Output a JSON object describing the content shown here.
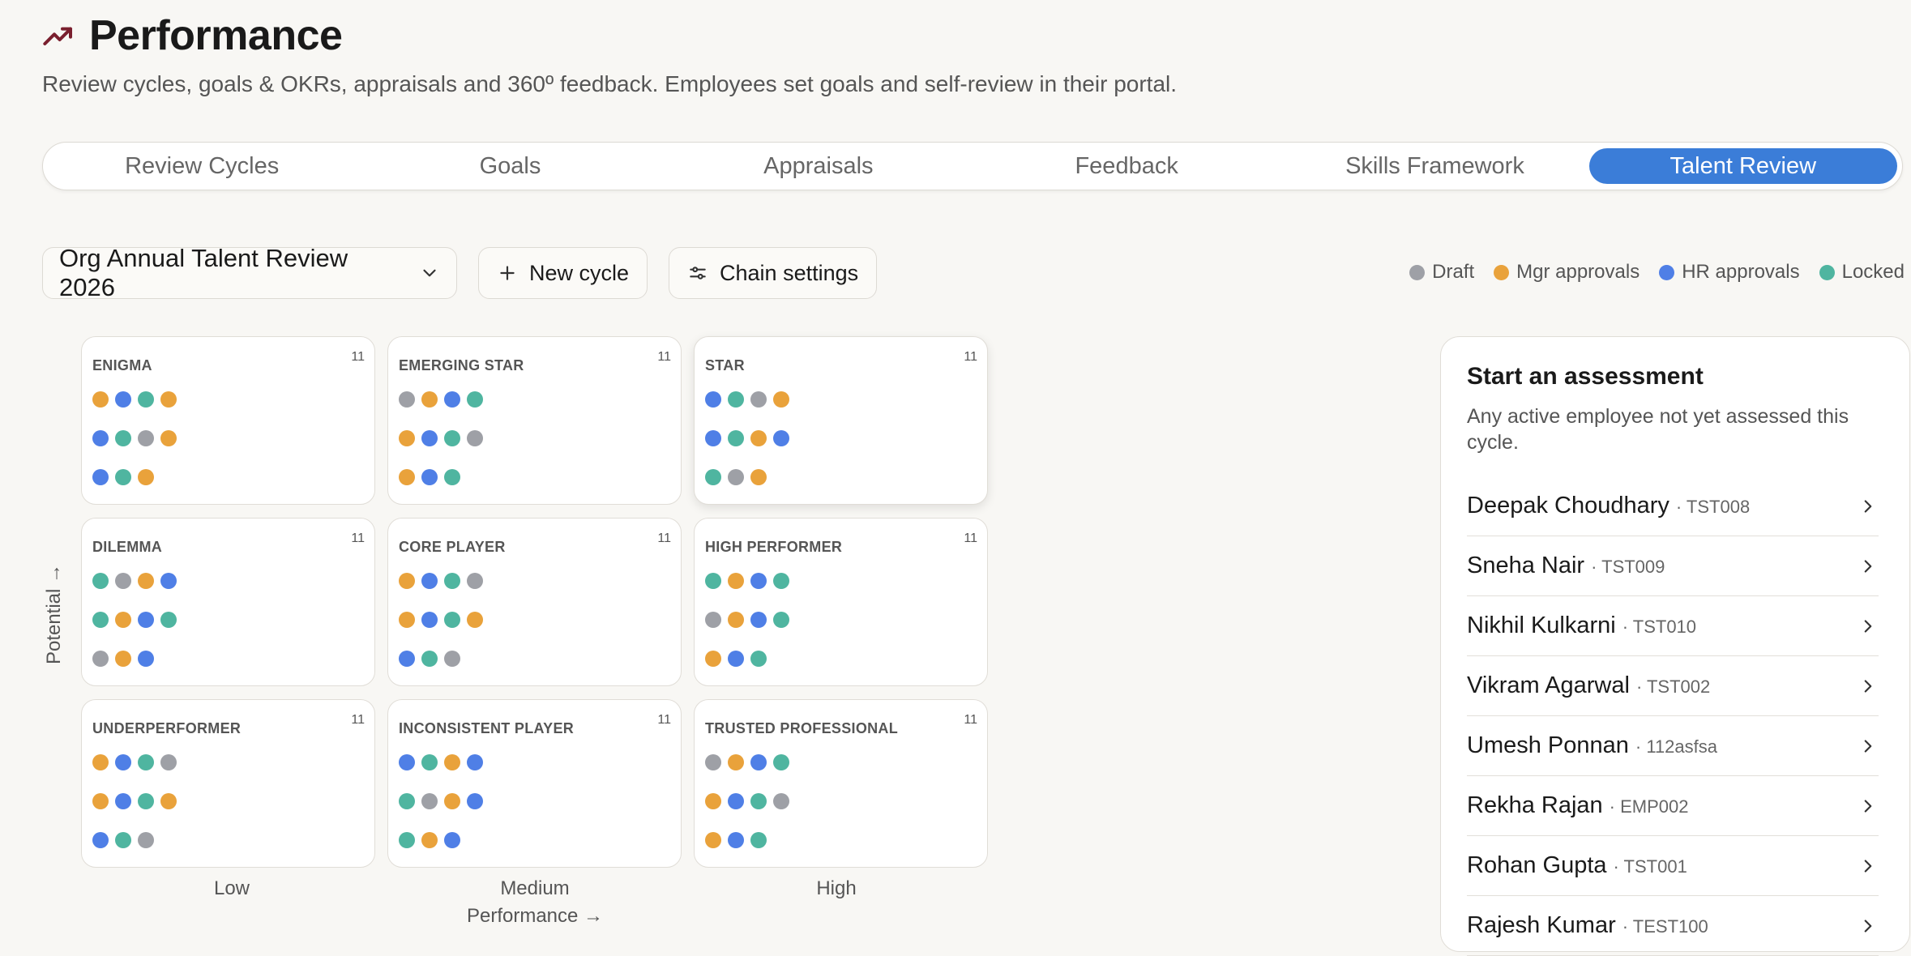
{
  "header": {
    "title": "Performance",
    "subtitle": "Review cycles, goals & OKRs, appraisals and 360º feedback. Employees set goals and self-review in their portal.",
    "accent": "#7a1f2e"
  },
  "tabs": [
    {
      "label": "Review Cycles",
      "active": false
    },
    {
      "label": "Goals",
      "active": false
    },
    {
      "label": "Appraisals",
      "active": false
    },
    {
      "label": "Feedback",
      "active": false
    },
    {
      "label": "Skills Framework",
      "active": false
    },
    {
      "label": "Talent Review",
      "active": true
    }
  ],
  "toolbar": {
    "cycle_select": "Org Annual Talent Review 2026",
    "new_cycle": "New cycle",
    "chain_settings": "Chain settings"
  },
  "colors": {
    "draft": "#9ea0a6",
    "mgr": "#e9a23b",
    "hr": "#4f7fe6",
    "locked": "#4fb5a0",
    "active_tab": "#3b7dd8"
  },
  "legend": [
    {
      "label": "Draft",
      "status": "draft"
    },
    {
      "label": "Mgr approvals",
      "status": "mgr"
    },
    {
      "label": "HR approvals",
      "status": "hr"
    },
    {
      "label": "Locked",
      "status": "locked"
    }
  ],
  "grid": {
    "cells": [
      {
        "title": "ENIGMA",
        "count": "11",
        "rows": [
          [
            "mgr",
            "hr",
            "locked",
            "mgr"
          ],
          [
            "hr",
            "locked",
            "draft",
            "mgr"
          ],
          [
            "hr",
            "locked",
            "mgr"
          ]
        ]
      },
      {
        "title": "EMERGING STAR",
        "count": "11",
        "rows": [
          [
            "draft",
            "mgr",
            "hr",
            "locked"
          ],
          [
            "mgr",
            "hr",
            "locked",
            "draft"
          ],
          [
            "mgr",
            "hr",
            "locked"
          ]
        ]
      },
      {
        "title": "STAR",
        "count": "11",
        "rows": [
          [
            "hr",
            "locked",
            "draft",
            "mgr"
          ],
          [
            "hr",
            "locked",
            "mgr",
            "hr"
          ],
          [
            "locked",
            "draft",
            "mgr"
          ]
        ]
      },
      {
        "title": "DILEMMA",
        "count": "11",
        "rows": [
          [
            "locked",
            "draft",
            "mgr",
            "hr"
          ],
          [
            "locked",
            "mgr",
            "hr",
            "locked"
          ],
          [
            "draft",
            "mgr",
            "hr"
          ]
        ]
      },
      {
        "title": "CORE PLAYER",
        "count": "11",
        "rows": [
          [
            "mgr",
            "hr",
            "locked",
            "draft"
          ],
          [
            "mgr",
            "hr",
            "locked",
            "mgr"
          ],
          [
            "hr",
            "locked",
            "draft"
          ]
        ]
      },
      {
        "title": "HIGH PERFORMER",
        "count": "11",
        "rows": [
          [
            "locked",
            "mgr",
            "hr",
            "locked"
          ],
          [
            "draft",
            "mgr",
            "hr",
            "locked"
          ],
          [
            "mgr",
            "hr",
            "locked"
          ]
        ]
      },
      {
        "title": "UNDERPERFORMER",
        "count": "11",
        "rows": [
          [
            "mgr",
            "hr",
            "locked",
            "draft"
          ],
          [
            "mgr",
            "hr",
            "locked",
            "mgr"
          ],
          [
            "hr",
            "locked",
            "draft"
          ]
        ]
      },
      {
        "title": "INCONSISTENT PLAYER",
        "count": "11",
        "rows": [
          [
            "hr",
            "locked",
            "mgr",
            "hr"
          ],
          [
            "locked",
            "draft",
            "mgr",
            "hr"
          ],
          [
            "locked",
            "mgr",
            "hr"
          ]
        ]
      },
      {
        "title": "TRUSTED PROFESSIONAL",
        "count": "11",
        "rows": [
          [
            "draft",
            "mgr",
            "hr",
            "locked"
          ],
          [
            "mgr",
            "hr",
            "locked",
            "draft"
          ],
          [
            "mgr",
            "hr",
            "locked"
          ]
        ]
      }
    ],
    "col_labels": [
      "Low",
      "Medium",
      "High"
    ],
    "x_axis": "Performance →",
    "y_axis": "Potential →"
  },
  "panel": {
    "title": "Start an assessment",
    "description": "Any active employee not yet assessed this cycle.",
    "employees": [
      {
        "name": "Deepak Choudhary",
        "code": "· TST008"
      },
      {
        "name": "Sneha Nair",
        "code": "· TST009"
      },
      {
        "name": "Nikhil Kulkarni",
        "code": "· TST010"
      },
      {
        "name": "Vikram Agarwal",
        "code": "· TST002"
      },
      {
        "name": "Umesh Ponnan",
        "code": "· 112asfsa"
      },
      {
        "name": "Rekha Rajan",
        "code": "· EMP002"
      },
      {
        "name": "Rohan Gupta",
        "code": "· TST001"
      },
      {
        "name": "Rajesh Kumar",
        "code": "· TEST100"
      }
    ]
  }
}
